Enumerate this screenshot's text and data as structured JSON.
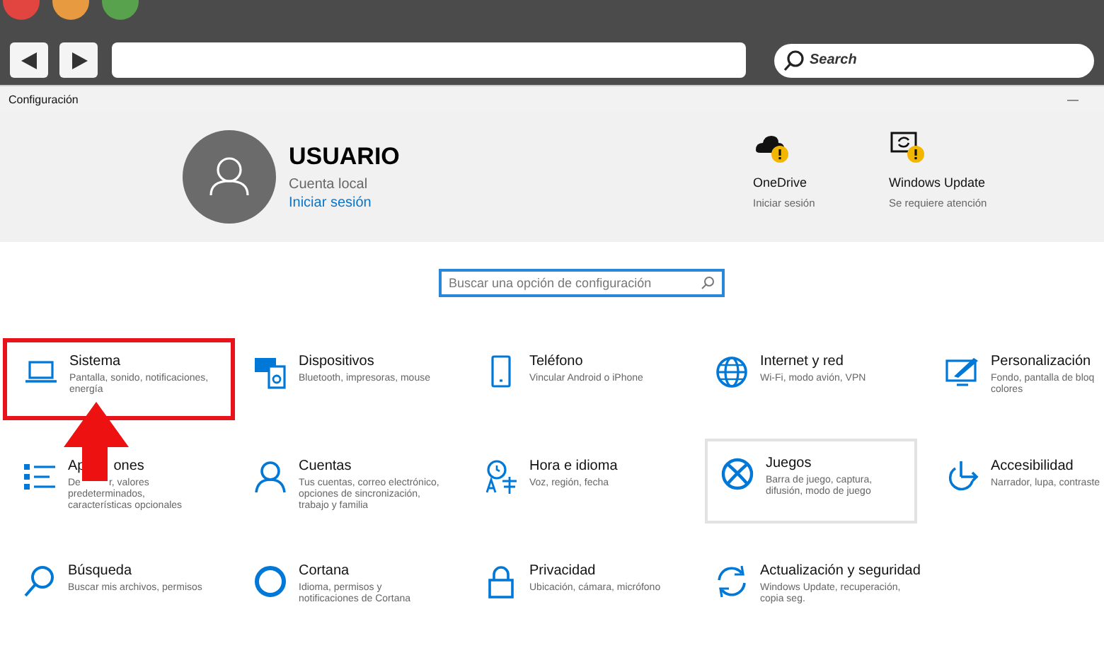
{
  "browser": {
    "search_placeholder": "Search"
  },
  "window": {
    "title": "Configuración",
    "minimize": "—"
  },
  "account": {
    "name": "USUARIO",
    "type": "Cuenta local",
    "link": "Iniciar sesión"
  },
  "status": [
    {
      "title": "OneDrive",
      "detail": "Iniciar sesión",
      "warning": true
    },
    {
      "title": "Windows Update",
      "detail": "Se requiere atención",
      "warning": true
    }
  ],
  "search": {
    "placeholder": "Buscar una opción de configuración"
  },
  "tiles": [
    {
      "title": [
        "Sistema"
      ],
      "lines": [
        [
          "Pantalla, sonido, notificaciones,"
        ],
        [
          "energía"
        ]
      ],
      "marked": true,
      "hovered": false
    },
    {
      "title": [
        "Dispositivos"
      ],
      "lines": [
        [
          "Bluetooth, impresoras, mouse"
        ]
      ],
      "marked": false,
      "hovered": false
    },
    {
      "title": [
        "Teléfono"
      ],
      "lines": [
        [
          "Vincular Android o iPhone"
        ]
      ],
      "marked": false,
      "hovered": false
    },
    {
      "title": [
        "Internet y red"
      ],
      "lines": [
        [
          "Wi-Fi, modo avión, VPN"
        ]
      ],
      "marked": false,
      "hovered": false
    },
    {
      "title": [
        "Personalización"
      ],
      "lines": [
        [
          "Fondo, pantalla de bloq"
        ],
        [
          "colores"
        ]
      ],
      "marked": false,
      "hovered": false
    },
    {
      "title": [
        "Ap",
        "ones"
      ],
      "lines": [
        [
          "De",
          "r, valores"
        ],
        [
          "predeterminados,"
        ],
        [
          "características opcionales"
        ]
      ],
      "marked": false,
      "hovered": false
    },
    {
      "title": [
        "Cuentas"
      ],
      "lines": [
        [
          "Tus cuentas, correo electrónico,"
        ],
        [
          "opciones de sincronización,"
        ],
        [
          "trabajo y familia"
        ]
      ],
      "marked": false,
      "hovered": false
    },
    {
      "title": [
        "Hora e idioma"
      ],
      "lines": [
        [
          "Voz, región, fecha"
        ]
      ],
      "marked": false,
      "hovered": false
    },
    {
      "title": [
        "Juegos"
      ],
      "lines": [
        [
          "Barra de juego, captura,"
        ],
        [
          "difusión, modo de juego"
        ]
      ],
      "marked": false,
      "hovered": true
    },
    {
      "title": [
        "Accesibilidad"
      ],
      "lines": [
        [
          "Narrador, lupa, contraste"
        ]
      ],
      "marked": false,
      "hovered": false
    },
    {
      "title": [
        "Búsqueda"
      ],
      "lines": [
        [
          "Buscar mis archivos, permisos"
        ]
      ],
      "marked": false,
      "hovered": false
    },
    {
      "title": [
        "Cortana"
      ],
      "lines": [
        [
          "Idioma, permisos y"
        ],
        [
          "notificaciones de Cortana"
        ]
      ],
      "marked": false,
      "hovered": false
    },
    {
      "title": [
        "Privacidad"
      ],
      "lines": [
        [
          "Ubicación, cámara, micrófono"
        ]
      ],
      "marked": false,
      "hovered": false
    },
    {
      "title": [
        "Actualización y seguridad"
      ],
      "lines": [
        [
          "Windows Update, recuperación,"
        ],
        [
          "copia seg."
        ]
      ],
      "marked": false,
      "hovered": false
    }
  ]
}
